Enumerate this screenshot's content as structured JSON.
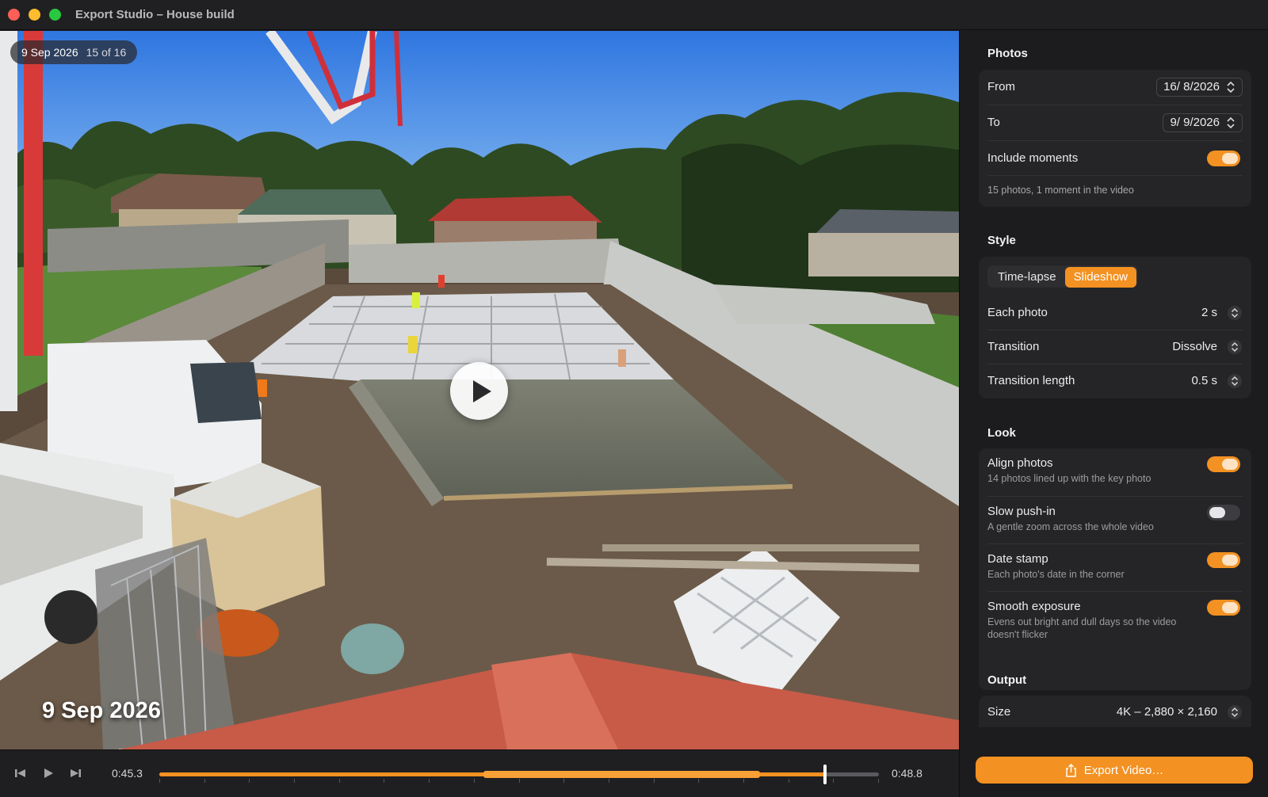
{
  "window": {
    "title": "Export Studio – House build"
  },
  "viewer": {
    "date_badge": "9 Sep 2026",
    "position_badge": "15 of 16",
    "date_stamp": "9 Sep 2026"
  },
  "transport": {
    "current_time": "0:45.3",
    "end_time": "0:48.8",
    "progress": 0.925,
    "selection_start": 0.45,
    "selection_end": 0.835,
    "icons": {
      "previous": "skip-back-icon",
      "play": "play-icon",
      "next": "skip-forward-icon"
    }
  },
  "photos": {
    "title": "Photos",
    "from_label": "From",
    "from_value": "16/ 8/2026",
    "to_label": "To",
    "to_value": "9/ 9/2026",
    "moments_label": "Include moments",
    "moments_on": true,
    "summary": "15 photos, 1 moment in the video"
  },
  "style": {
    "title": "Style",
    "modes": [
      "Time-lapse",
      "Slideshow"
    ],
    "selected_mode": "Slideshow",
    "each_photo_label": "Each photo",
    "each_photo_value": "2 s",
    "transition_label": "Transition",
    "transition_value": "Dissolve",
    "transition_length_label": "Transition length",
    "transition_length_value": "0.5 s"
  },
  "look": {
    "title": "Look",
    "options": [
      {
        "label": "Align photos",
        "description": "14 photos lined up with the key photo",
        "on": true
      },
      {
        "label": "Slow push-in",
        "description": "A gentle zoom across the whole video",
        "on": false
      },
      {
        "label": "Date stamp",
        "description": "Each photo's date in the corner",
        "on": true
      },
      {
        "label": "Smooth exposure",
        "description": "Evens out bright and dull days so the video doesn't flicker",
        "on": true
      }
    ]
  },
  "output": {
    "title": "Output",
    "size_label": "Size",
    "size_value": "4K – 2,880 × 2,160",
    "export_label": "Export Video…"
  },
  "colors": {
    "accent": "#f39122",
    "background": "#1c1c1e",
    "card": "#252527"
  }
}
